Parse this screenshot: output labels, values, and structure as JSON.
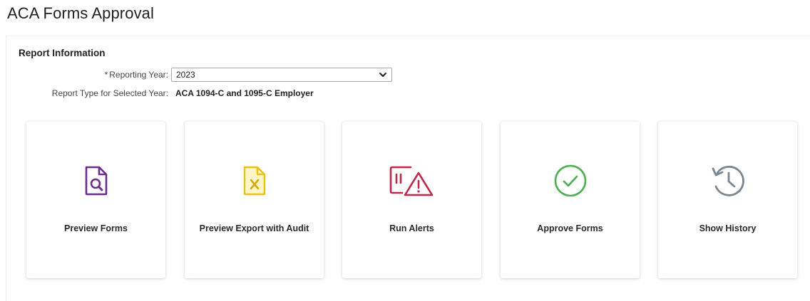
{
  "page": {
    "title": "ACA Forms Approval"
  },
  "report_info": {
    "section_title": "Report Information",
    "reporting_year": {
      "required_marker": "*",
      "label": "Reporting Year:",
      "value": "2023"
    },
    "report_type": {
      "label": "Report Type for Selected Year:",
      "value": "ACA 1094-C and 1095-C Employer"
    }
  },
  "tiles": [
    {
      "label": "Preview Forms",
      "icon": "document-search-icon",
      "color": "#6b2d8a"
    },
    {
      "label": "Preview Export with Audit",
      "icon": "excel-file-icon",
      "color": "#e8c21a"
    },
    {
      "label": "Run Alerts",
      "icon": "alert-triangle-icon",
      "color": "#c0284a"
    },
    {
      "label": "Approve Forms",
      "icon": "check-circle-icon",
      "color": "#4caf50"
    },
    {
      "label": "Show History",
      "icon": "history-icon",
      "color": "#7a8790"
    }
  ]
}
